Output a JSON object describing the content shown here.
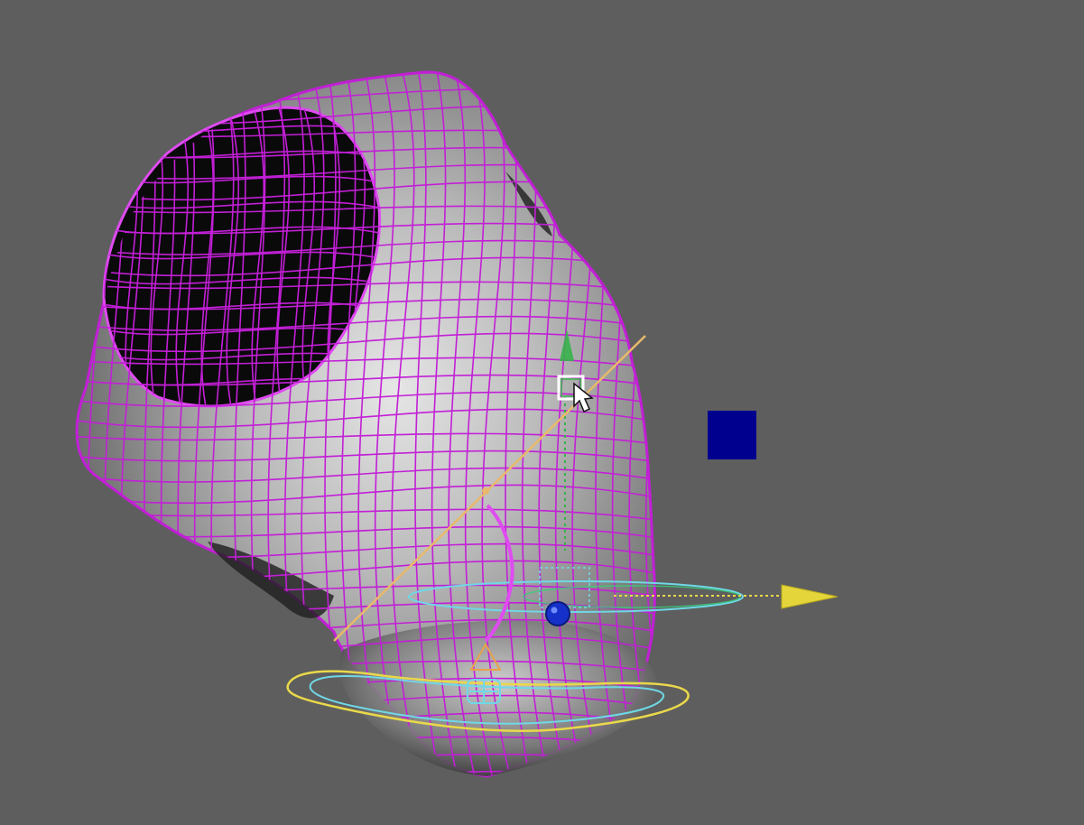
{
  "viewport": {
    "background": "#5e5e5e",
    "icons": [
      "mesh-wireframe-icon",
      "rotate-gizmo-icon",
      "move-handle-icon",
      "mouse-cursor-icon",
      "blue-square-marker-icon"
    ]
  },
  "colors": {
    "wire": "#c21fd6",
    "wire_bright": "#e04bf2",
    "shell_light": "#d8d8d8",
    "shell_dark": "#252525",
    "hole": "#0a0a0a",
    "gizmo_yellow": "#e9d84a",
    "gizmo_orange": "#e8b96a",
    "gizmo_cyan": "#6fd8e6",
    "gizmo_green": "#37b34a",
    "marker_blue": "#00008f"
  }
}
